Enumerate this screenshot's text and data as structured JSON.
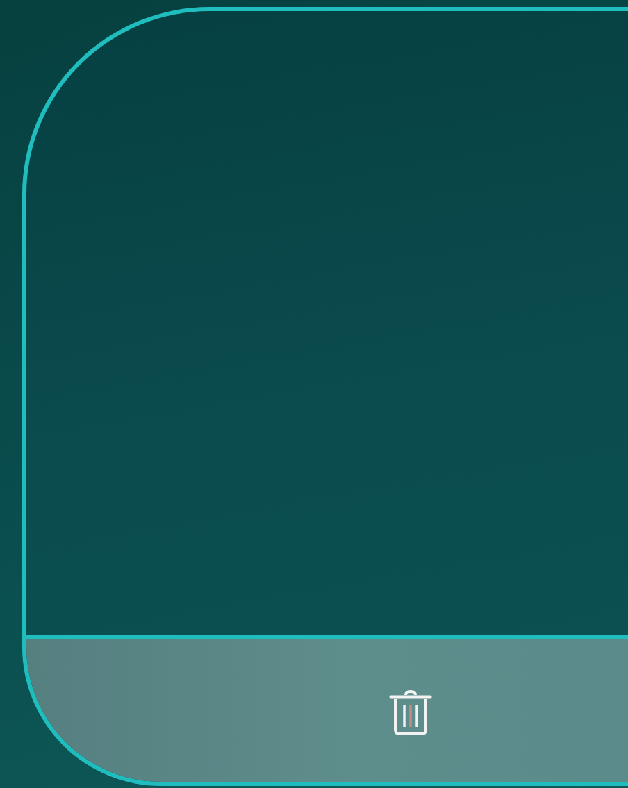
{
  "card": {
    "footer_actions": [
      {
        "kind": "delete"
      }
    ]
  }
}
